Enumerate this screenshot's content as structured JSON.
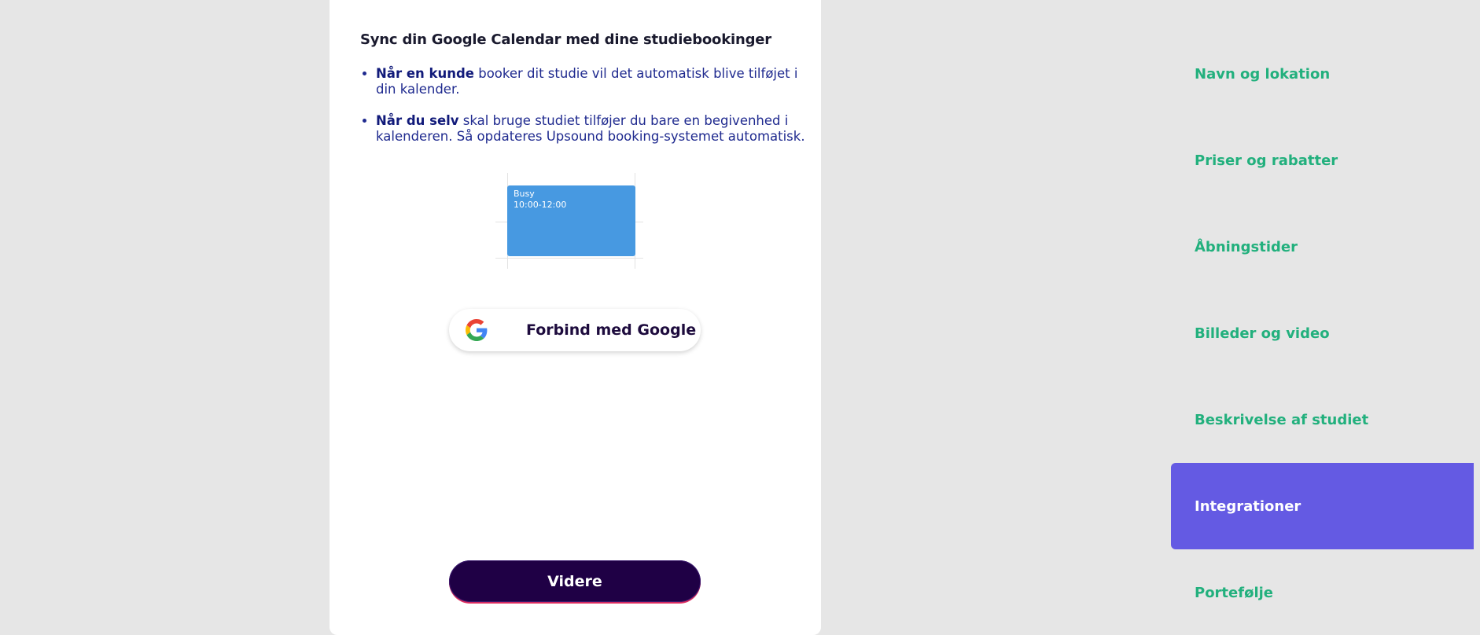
{
  "card": {
    "title": "Sync din Google Calendar med dine studiebookinger",
    "bullets": [
      {
        "bold": "Når en kunde",
        "text": " booker dit studie vil det automatisk blive tilføjet i din kalender."
      },
      {
        "bold": "Når du selv",
        "text": " skal bruge studiet tilføjer du bare en begivenhed i kalenderen. Så opdateres Upsound booking-systemet automatisk."
      }
    ],
    "calendar_event": {
      "title": "Busy",
      "time": "10:00-12:00",
      "color": "#4799e1"
    },
    "google_button": {
      "icon": "google-g-icon",
      "label": "Forbind med Google"
    },
    "next_button": {
      "label": "Videre"
    }
  },
  "side_nav": {
    "items": [
      {
        "label": "Navn og lokation",
        "active": false
      },
      {
        "label": "Priser og rabatter",
        "active": false
      },
      {
        "label": "Åbningstider",
        "active": false
      },
      {
        "label": "Billeder og video",
        "active": false
      },
      {
        "label": "Beskrivelse af studiet",
        "active": false
      },
      {
        "label": "Integrationer",
        "active": true
      },
      {
        "label": "Portefølje",
        "active": false
      }
    ]
  },
  "colors": {
    "background": "#e6e6e6",
    "nav_text": "#22b07d",
    "nav_active_bg": "#645ae3",
    "primary_button": "#1f0045",
    "bullet_text": "#1f2a8f"
  }
}
